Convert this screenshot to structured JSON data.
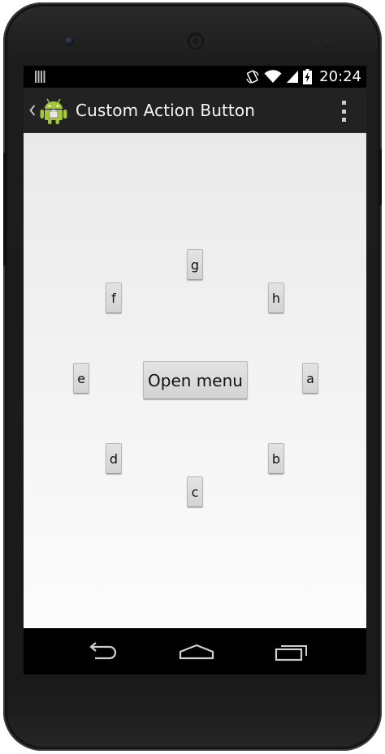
{
  "device": {
    "name": "Android phone"
  },
  "status_bar": {
    "time": "20:24",
    "icons": [
      "notification-bars-icon",
      "rotate-icon",
      "wifi-icon",
      "signal-icon",
      "battery-charging-icon"
    ]
  },
  "action_bar": {
    "title": "Custom Action Button",
    "up_icon": "chevron-left-icon",
    "app_icon": "android-robot-icon",
    "overflow_icon": "overflow-menu-icon"
  },
  "menu": {
    "open_label": "Open menu",
    "items": {
      "a": "a",
      "b": "b",
      "c": "c",
      "d": "d",
      "e": "e",
      "f": "f",
      "g": "g",
      "h": "h"
    }
  },
  "nav_bar": {
    "icons": [
      "back-icon",
      "home-icon",
      "recents-icon"
    ]
  },
  "colors": {
    "action_bar_bg": "#222222",
    "button_bg": "#d6d6d6",
    "content_bg": "#f3f3f3"
  }
}
